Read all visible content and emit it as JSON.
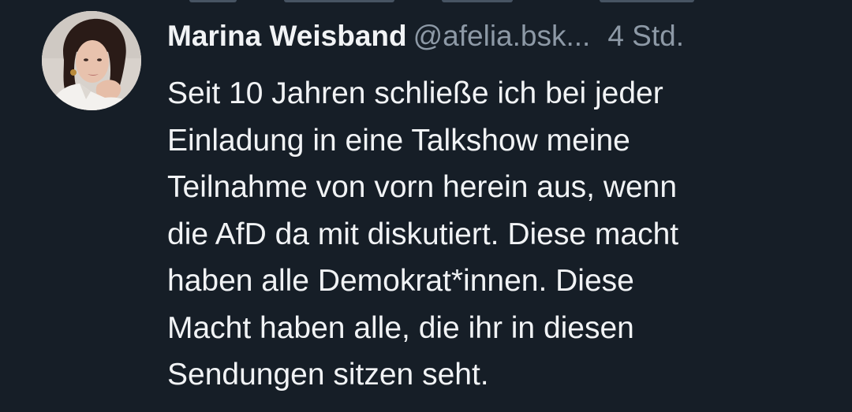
{
  "post": {
    "author": {
      "display_name": "Marina Weisband",
      "handle": "@afelia.bsk...",
      "avatar_icon": "user-avatar-photo"
    },
    "timestamp": "4 Std.",
    "text_lines": [
      "Seit 10 Jahren schließe ich bei jeder",
      "Einladung in eine Talkshow meine",
      "Teilnahme von vorn herein aus, wenn",
      "die AfD da mit diskutiert. Diese macht",
      "haben alle Demokrat*innen. Diese",
      "Macht haben alle, die ihr in diesen",
      "Sendungen sitzen seht."
    ]
  },
  "colors": {
    "background": "#161e27",
    "text_primary": "#f1f3f5",
    "text_secondary": "#8d99a6"
  }
}
